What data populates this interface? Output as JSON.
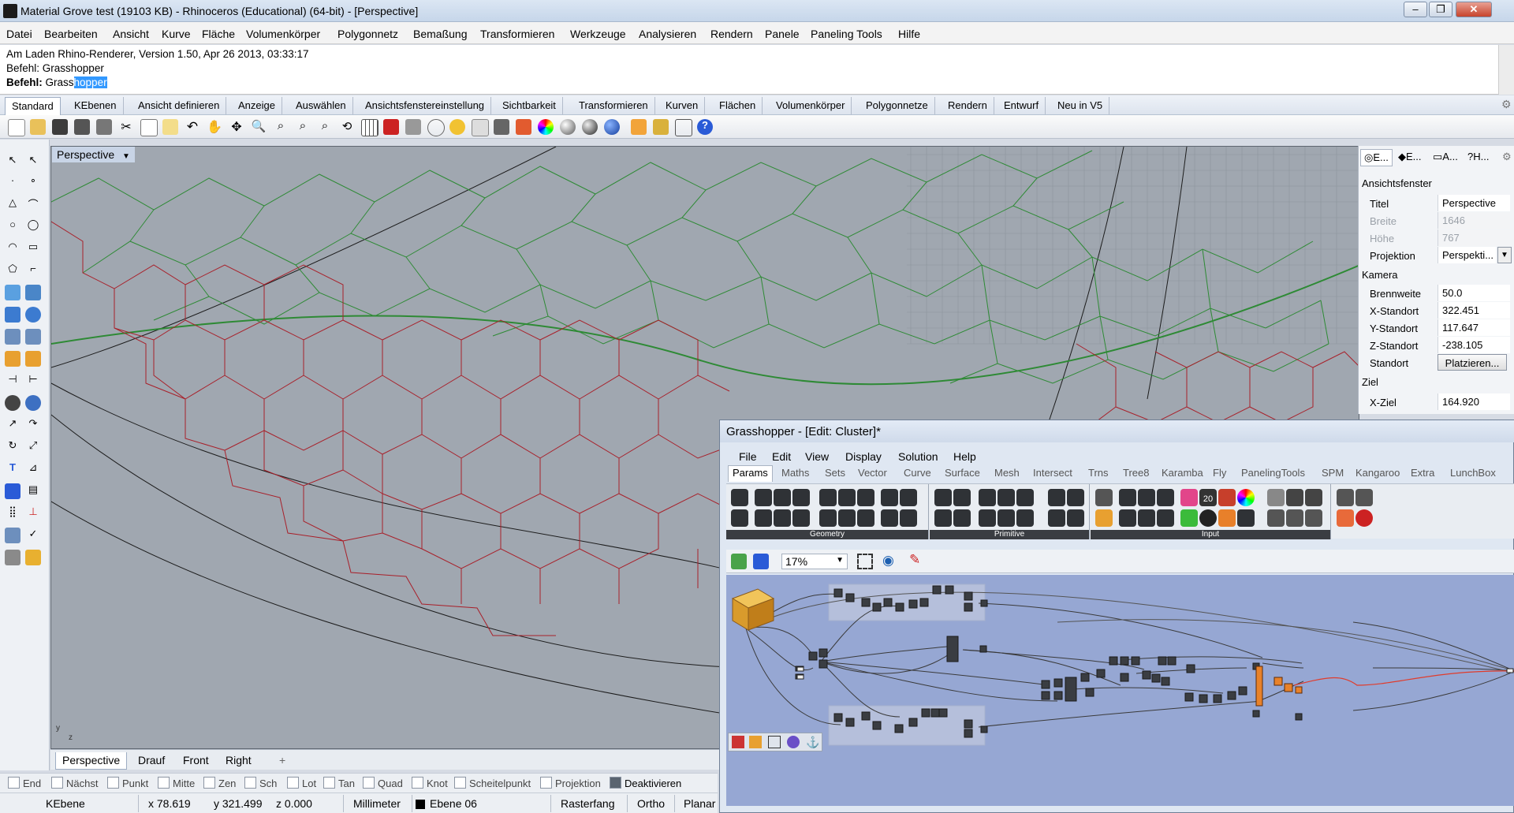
{
  "window": {
    "title": "Material Grove test (19103 KB) - Rhinoceros (Educational) (64-bit) - [Perspective]",
    "minimize": "‒",
    "maximize": "❐",
    "close": "✕"
  },
  "menu": [
    "Datei",
    "Bearbeiten",
    "Ansicht",
    "Kurve",
    "Fläche",
    "Volumenkörper",
    "Polygonnetz",
    "Bemaßung",
    "Transformieren",
    "Werkzeuge",
    "Analysieren",
    "Rendern",
    "Panele",
    "Paneling Tools",
    "Hilfe"
  ],
  "command": {
    "line1": "Am Laden Rhino-Renderer, Version 1.50, Apr 26 2013, 03:33:17",
    "line2": "Befehl: Grasshopper",
    "prompt": "Befehl:",
    "typed": " Grass",
    "selected": "hopper"
  },
  "tabs": [
    "Standard",
    "KEbenen",
    "Ansicht definieren",
    "Anzeige",
    "Auswählen",
    "Ansichtsfenstereinstellung",
    "Sichtbarkeit",
    "Transformieren",
    "Kurven",
    "Flächen",
    "Volumenkörper",
    "Polygonnetze",
    "Rendern",
    "Entwurf",
    "Neu in V5"
  ],
  "viewport": {
    "label": "Perspective",
    "tabs": [
      "Perspective",
      "Drauf",
      "Front",
      "Right"
    ],
    "add_tab": "+"
  },
  "osnaps": [
    {
      "label": "End",
      "checked": false
    },
    {
      "label": "Nächst",
      "checked": false
    },
    {
      "label": "Punkt",
      "checked": false
    },
    {
      "label": "Mitte",
      "checked": false
    },
    {
      "label": "Zen",
      "checked": false
    },
    {
      "label": "Sch",
      "checked": false
    },
    {
      "label": "Lot",
      "checked": false
    },
    {
      "label": "Tan",
      "checked": false
    },
    {
      "label": "Quad",
      "checked": false
    },
    {
      "label": "Knot",
      "checked": false
    },
    {
      "label": "Scheitelpunkt",
      "checked": false
    },
    {
      "label": "Projektion",
      "checked": false
    },
    {
      "label": "Deaktivieren",
      "checked": true
    }
  ],
  "status": {
    "layer_btn": "KEbene",
    "x": "x 78.619",
    "y": "y 321.499",
    "z": "z 0.000",
    "units": "Millimeter",
    "layer": "Ebene 06",
    "snap": "Rasterfang",
    "ortho": "Ortho",
    "planar": "Planar"
  },
  "properties": {
    "tabs": [
      "E...",
      "E...",
      "A...",
      "H..."
    ],
    "section1": "Ansichtsfenster",
    "rows1": [
      {
        "k": "Titel",
        "v": "Perspective",
        "dim": false
      },
      {
        "k": "Breite",
        "v": "1646",
        "dim": true
      },
      {
        "k": "Höhe",
        "v": "767",
        "dim": true
      },
      {
        "k": "Projektion",
        "v": "Perspekti...",
        "dim": false
      }
    ],
    "section2": "Kamera",
    "rows2": [
      {
        "k": "Brennweite",
        "v": "50.0",
        "dim": false
      },
      {
        "k": "X-Standort",
        "v": "322.451",
        "dim": false
      },
      {
        "k": "Y-Standort",
        "v": "117.647",
        "dim": false
      },
      {
        "k": "Z-Standort",
        "v": "-238.105",
        "dim": false
      },
      {
        "k": "Standort",
        "v": "Platzieren...",
        "dim": false
      }
    ],
    "section3": "Ziel",
    "rows3": [
      {
        "k": "X-Ziel",
        "v": "164.920",
        "dim": false
      }
    ]
  },
  "grasshopper": {
    "title": "Grasshopper - [Edit: Cluster]*",
    "menu": [
      "File",
      "Edit",
      "View",
      "Display",
      "Solution",
      "Help"
    ],
    "tabs": [
      "Params",
      "Maths",
      "Sets",
      "Vector",
      "Curve",
      "Surface",
      "Mesh",
      "Intersect",
      "Trns",
      "Tree8",
      "Karamba",
      "Fly",
      "PanelingTools",
      "SPM",
      "Kangaroo",
      "Extra",
      "LunchBox"
    ],
    "groups": [
      "Geometry",
      "Primitive",
      "Input"
    ],
    "zoom": "17%",
    "badge": "20"
  },
  "colors": {
    "viewport_bg": "#a0a7b0",
    "red_mesh": "#a8202a",
    "green_mesh": "#2e8a35",
    "gh_canvas": "#96a7d3"
  }
}
